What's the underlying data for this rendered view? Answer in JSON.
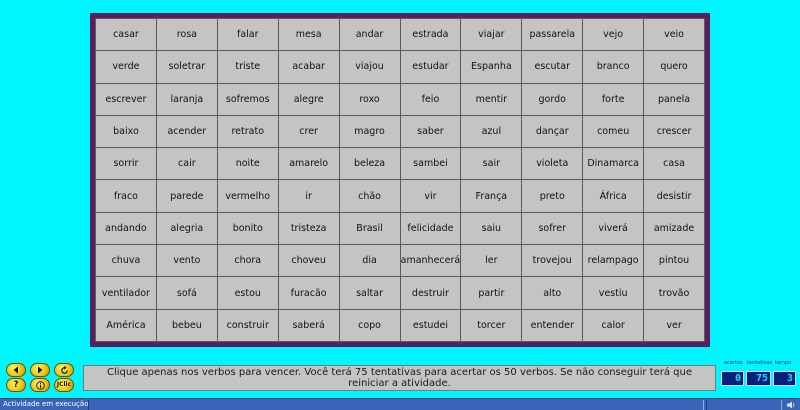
{
  "words": [
    [
      "casar",
      "rosa",
      "falar",
      "mesa",
      "andar",
      "estrada",
      "viajar",
      "passarela",
      "vejo",
      "veio"
    ],
    [
      "verde",
      "soletrar",
      "triste",
      "acabar",
      "viajou",
      "estudar",
      "Espanha",
      "escutar",
      "branco",
      "quero"
    ],
    [
      "escrever",
      "laranja",
      "sofremos",
      "alegre",
      "roxo",
      "feio",
      "mentir",
      "gordo",
      "forte",
      "panela"
    ],
    [
      "baixo",
      "acender",
      "retrato",
      "crer",
      "magro",
      "saber",
      "azul",
      "dançar",
      "comeu",
      "crescer"
    ],
    [
      "sorrir",
      "cair",
      "noite",
      "amarelo",
      "beleza",
      "sambei",
      "sair",
      "violeta",
      "Dinamarca",
      "casa"
    ],
    [
      "fraco",
      "parede",
      "vermelho",
      "ir",
      "chão",
      "vir",
      "França",
      "preto",
      "África",
      "desistir"
    ],
    [
      "andando",
      "alegria",
      "bonito",
      "tristeza",
      "Brasil",
      "felicidade",
      "saiu",
      "sofrer",
      "viverá",
      "amizade"
    ],
    [
      "chuva",
      "vento",
      "chora",
      "choveu",
      "dia",
      "amanhecerá",
      "ler",
      "trovejou",
      "relampago",
      "pintou"
    ],
    [
      "ventilador",
      "sofá",
      "estou",
      "furacão",
      "saltar",
      "destruir",
      "partir",
      "alto",
      "vestiu",
      "trovão"
    ],
    [
      "América",
      "bebeu",
      "construir",
      "saberá",
      "copo",
      "estudei",
      "torcer",
      "entender",
      "calor",
      "ver"
    ]
  ],
  "message": "Clique apenas nos verbos para vencer. Você terá 75 tentativas para acertar os 50 verbos. Se não conseguir terá que reiniciar a atividade.",
  "counters": {
    "acertos_label": "acertos",
    "tentativas_label": "tentativas",
    "tempo_label": "tempo",
    "acertos": "0",
    "tentativas": "75",
    "tempo": "3"
  },
  "buttons": {
    "jclic_label": "JClic",
    "help_label": "?",
    "info_label": "i"
  },
  "status": "Actividade em execução",
  "colors": {
    "background": "#00f6ff",
    "board_border": "#5a1f5e",
    "cell": "#c4c4c4",
    "button": "#f2d200",
    "statusbar": "#3a64b8"
  },
  "icons": [
    "prev-arrow-icon",
    "next-arrow-icon",
    "restart-icon",
    "help-icon",
    "info-icon",
    "jclic-logo-icon",
    "sound-icon"
  ]
}
